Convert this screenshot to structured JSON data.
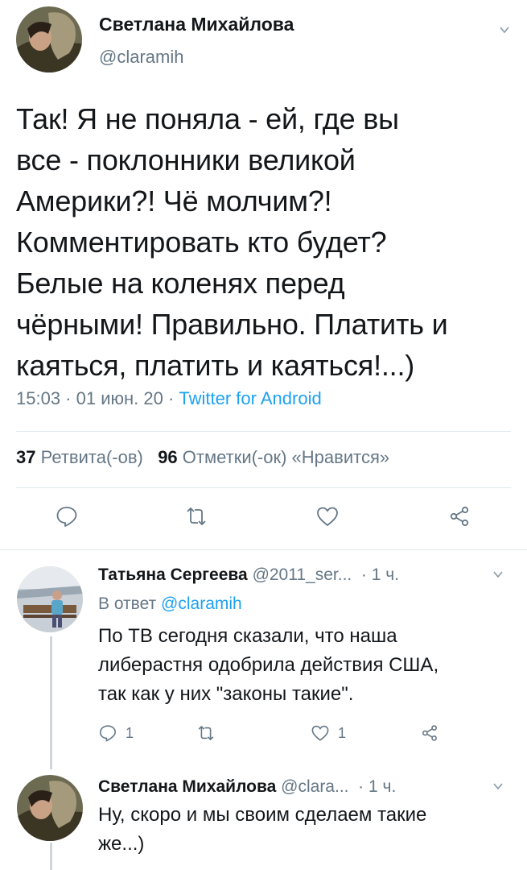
{
  "main_tweet": {
    "author_name": "Светлана Михайлова",
    "handle": "@claramih",
    "text_lines": [
      "Так!  Я не поняла - ей, где вы",
      "все - поклонники великой",
      "Америки?! Чё молчим?!",
      "Комментировать кто будет?",
      "Белые на коленях перед",
      "чёрными! Правильно. Платить и",
      "каяться, платить и каяться!...)"
    ],
    "time": "15:03",
    "date": "01 июн. 20",
    "separator": " · ",
    "source": "Twitter for Android",
    "retweets_count": "37",
    "retweets_label": "Ретвита(-ов)",
    "likes_count": "96",
    "likes_label": "Отметки(-ок) «Нравится»",
    "icons": [
      "reply-icon",
      "retweet-icon",
      "like-icon",
      "share-icon"
    ]
  },
  "replies": [
    {
      "author_name": "Татьяна Сергеева",
      "handle": "@2011_ser...",
      "time": "· 1 ч.",
      "reply_prefix": "В ответ ",
      "reply_to": "@claramih",
      "text_lines": [
        "По ТВ сегодня сказали, что наша",
        "либерастня одобрила действия США,",
        "так как у них \"законы такие\"."
      ],
      "reply_count": "1",
      "like_count": "1"
    },
    {
      "author_name": "Светлана Михайлова",
      "handle": "@clara...",
      "time": "· 1 ч.",
      "text_lines": [
        "Ну, скоро и мы своим сделаем такие",
        "же...)"
      ]
    }
  ],
  "colors": {
    "link": "#1da1f2",
    "secondary_text": "#657786",
    "primary_text": "#14171a",
    "divider": "#e1e8ed"
  }
}
